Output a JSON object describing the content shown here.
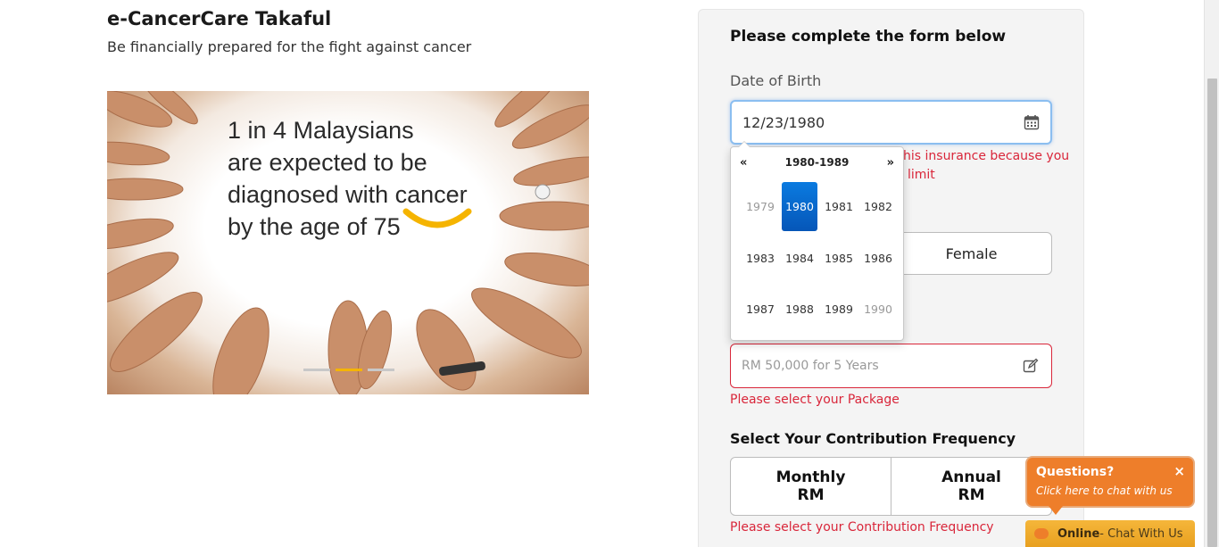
{
  "hero": {
    "title": "e-CancerCare Takaful",
    "subtitle": "Be financially prepared for the fight against cancer",
    "banner_lines": [
      "1 in 4 Malaysians",
      "are expected to be",
      "diagnosed with cancer",
      "by the age of 75"
    ],
    "carousel": {
      "total": 3,
      "active": 2
    }
  },
  "form": {
    "title": "Please complete the form below",
    "dob_label": "Date of Birth",
    "dob_value": "12/23/1980",
    "dob_error_line1": "his insurance because you",
    "dob_error_line2": "limit",
    "gender_female": "Female",
    "package_placeholder": "RM 50,000 for 5 Years",
    "package_error": "Please select your Package",
    "frequency_title": "Select Your Contribution Frequency",
    "frequency_options": [
      {
        "label": "Monthly",
        "sub": "RM"
      },
      {
        "label": "Annual",
        "sub": "RM"
      }
    ],
    "frequency_error": "Please select your Contribution Frequency"
  },
  "datepicker": {
    "prev": "«",
    "next": "»",
    "range": "1980-1989",
    "years": [
      "1979",
      "1980",
      "1981",
      "1982",
      "1983",
      "1984",
      "1985",
      "1986",
      "1987",
      "1988",
      "1989",
      "1990"
    ],
    "selected": "1980",
    "muted": [
      "1979",
      "1990"
    ]
  },
  "chat": {
    "question": "Questions?",
    "subtitle": "Click here to chat with us",
    "close": "×",
    "status": "Online",
    "action": " - Chat With Us"
  },
  "colors": {
    "error": "#d9263a",
    "accent_orange": "#ee7e2a",
    "selected_blue": "#0a7be0",
    "carousel_active": "#f5b400"
  }
}
